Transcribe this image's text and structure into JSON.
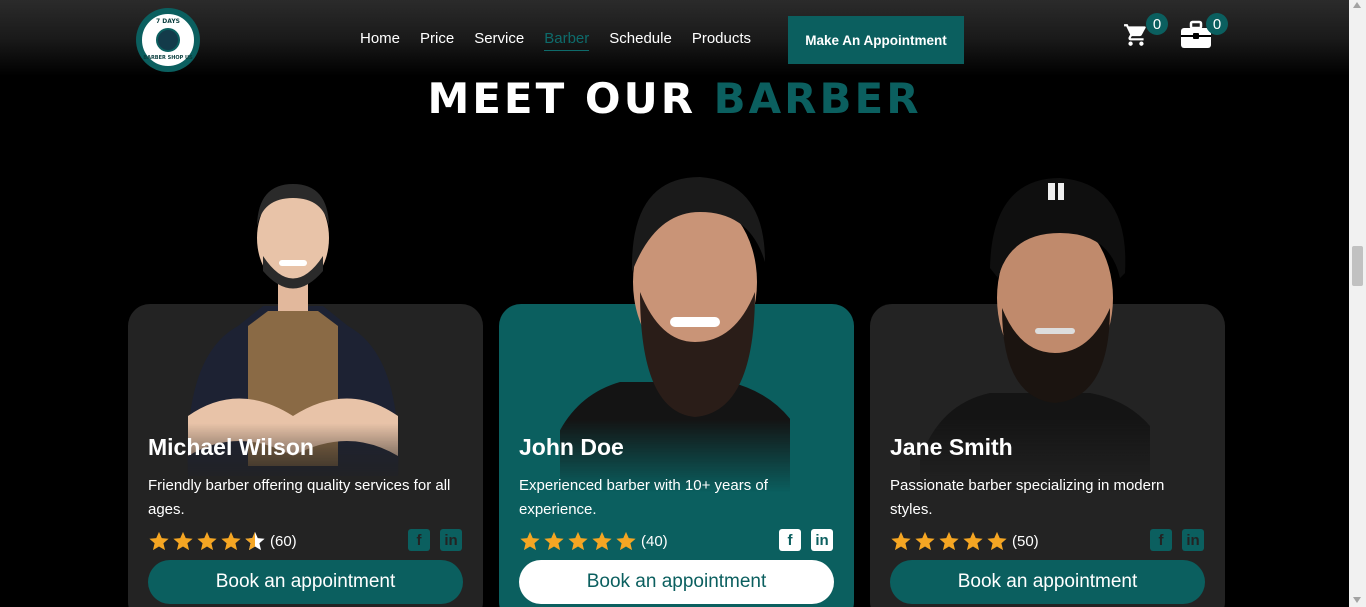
{
  "logo": {
    "top_text": "7 DAYS",
    "bottom_text": "BARBER SHOP US"
  },
  "nav": {
    "items": [
      {
        "label": "Home"
      },
      {
        "label": "Price"
      },
      {
        "label": "Service"
      },
      {
        "label": "Barber",
        "active": true
      },
      {
        "label": "Schedule"
      },
      {
        "label": "Products"
      }
    ],
    "cta_label": "Make An Appointment"
  },
  "cart": {
    "icon": "cart-icon",
    "count": "0"
  },
  "bag": {
    "icon": "toolbox-icon",
    "count": "0"
  },
  "section": {
    "title_part1": "MEET OUR ",
    "title_part2": "BARBER"
  },
  "barbers": [
    {
      "name": "Michael Wilson",
      "description": "Friendly barber offering quality services for all ages.",
      "rating": 4.5,
      "reviews": "(60)",
      "cta": "Book an appointment",
      "featured": false
    },
    {
      "name": "John Doe",
      "description": "Experienced barber with 10+ years of experience.",
      "rating": 5,
      "reviews": "(40)",
      "cta": "Book an appointment",
      "featured": true
    },
    {
      "name": "Jane Smith",
      "description": "Passionate barber specializing in modern styles.",
      "rating": 5,
      "reviews": "(50)",
      "cta": "Book an appointment",
      "featured": false
    }
  ],
  "colors": {
    "accent": "#0b5f5f",
    "star": "#f5a623",
    "card_bg": "#232323"
  }
}
